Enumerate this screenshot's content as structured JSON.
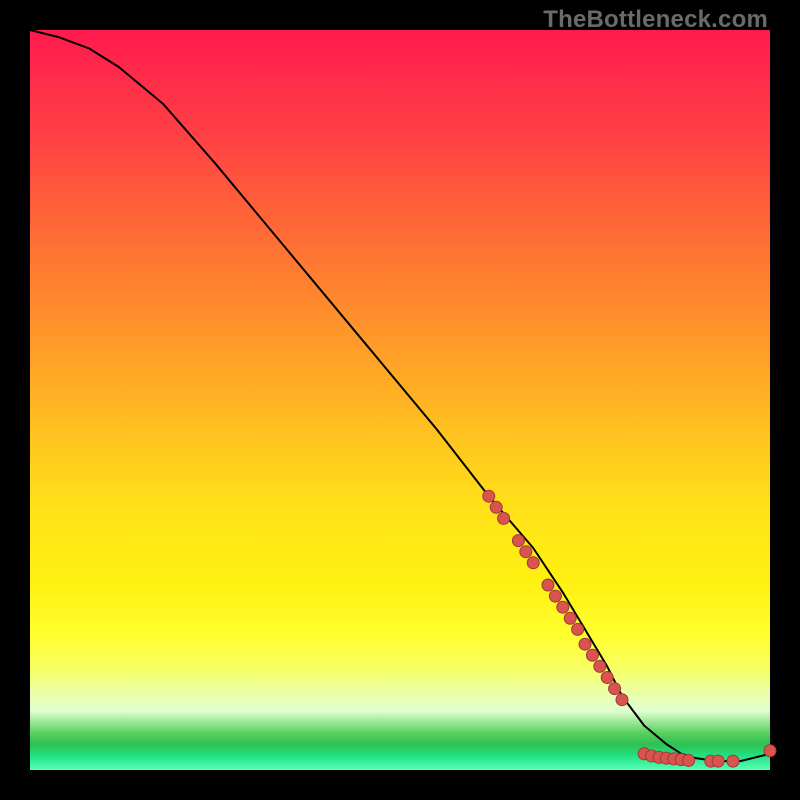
{
  "watermark": "TheBottleneck.com",
  "chart_data": {
    "type": "line",
    "title": "",
    "xlabel": "",
    "ylabel": "",
    "xlim": [
      0,
      100
    ],
    "ylim": [
      0,
      100
    ],
    "grid": false,
    "legend": false,
    "series": [
      {
        "name": "curve",
        "x": [
          0,
          4,
          8,
          12,
          18,
          25,
          35,
          45,
          55,
          62,
          68,
          72,
          75,
          78,
          80,
          83,
          86,
          88,
          90,
          92,
          94,
          96,
          100
        ],
        "y": [
          100,
          99,
          97.5,
          95,
          90,
          82,
          70,
          58,
          46,
          37,
          30,
          24,
          19,
          14,
          10,
          6,
          3.5,
          2.2,
          1.6,
          1.3,
          1.2,
          1.2,
          2.2
        ]
      }
    ],
    "points": [
      {
        "x": 62,
        "y": 37
      },
      {
        "x": 63,
        "y": 35.5
      },
      {
        "x": 64,
        "y": 34
      },
      {
        "x": 66,
        "y": 31
      },
      {
        "x": 67,
        "y": 29.5
      },
      {
        "x": 68,
        "y": 28
      },
      {
        "x": 70,
        "y": 25
      },
      {
        "x": 71,
        "y": 23.5
      },
      {
        "x": 72,
        "y": 22
      },
      {
        "x": 73,
        "y": 20.5
      },
      {
        "x": 74,
        "y": 19
      },
      {
        "x": 75,
        "y": 17
      },
      {
        "x": 76,
        "y": 15.5
      },
      {
        "x": 77,
        "y": 14
      },
      {
        "x": 78,
        "y": 12.5
      },
      {
        "x": 79,
        "y": 11
      },
      {
        "x": 80,
        "y": 9.5
      },
      {
        "x": 83,
        "y": 2.2
      },
      {
        "x": 84,
        "y": 1.9
      },
      {
        "x": 85,
        "y": 1.7
      },
      {
        "x": 86,
        "y": 1.6
      },
      {
        "x": 87,
        "y": 1.5
      },
      {
        "x": 88,
        "y": 1.4
      },
      {
        "x": 89,
        "y": 1.3
      },
      {
        "x": 92,
        "y": 1.2
      },
      {
        "x": 93,
        "y": 1.2
      },
      {
        "x": 95,
        "y": 1.2
      },
      {
        "x": 100,
        "y": 2.6
      }
    ]
  }
}
